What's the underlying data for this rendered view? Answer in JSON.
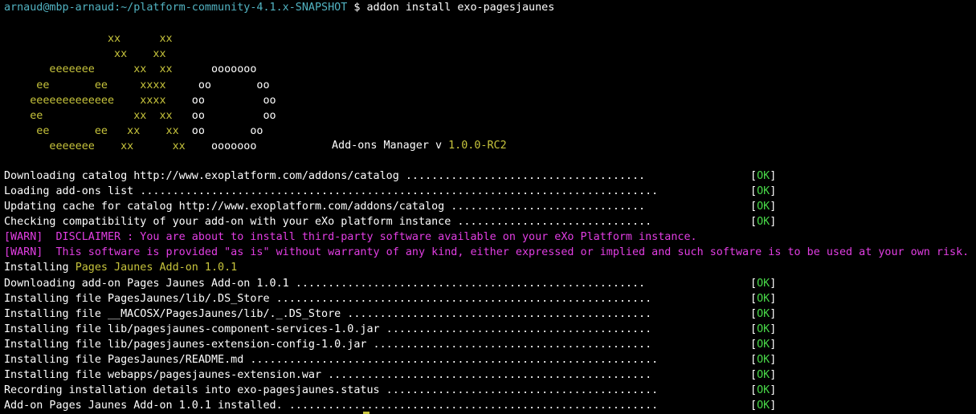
{
  "prompt": {
    "user_host": "arnaud@mbp-arnaud",
    "path": ":~/platform-community-4.1.x-SNAPSHOT",
    "symbol": " $ ",
    "command": "addon install exo-pagesjaunes"
  },
  "banner": {
    "art_lines": [
      {
        "y": "                xx      xx",
        "w": ""
      },
      {
        "y": "                 xx    xx",
        "w": ""
      },
      {
        "y": "       eeeeeee      xx  xx",
        "w": "      ooooooo"
      },
      {
        "y": "     ee       ee     xxxx",
        "w": "     oo       oo"
      },
      {
        "y": "    eeeeeeeeeeeee    xxxx",
        "w": "    oo         oo"
      },
      {
        "y": "    ee              xx  xx",
        "w": "   oo         oo"
      },
      {
        "y": "     ee       ee   xx    xx",
        "w": "  oo       oo"
      },
      {
        "y": "       eeeeeee    xx      xx",
        "w": "    ooooooo"
      }
    ],
    "manager_label": "Add-ons Manager v ",
    "manager_version": "1.0.0-RC2"
  },
  "lines": [
    {
      "type": "ok",
      "text": "Downloading catalog http://www.exoplatform.com/addons/catalog ..................................... "
    },
    {
      "type": "ok",
      "text": "Loading add-ons list ................................................................................ "
    },
    {
      "type": "ok",
      "text": "Updating cache for catalog http://www.exoplatform.com/addons/catalog .............................. "
    },
    {
      "type": "ok",
      "text": "Checking compatibility of your add-on with your eXo platform instance .............................. "
    },
    {
      "type": "warn",
      "text": "[WARN]  DISCLAIMER : You are about to install third-party software available on your eXo Platform instance."
    },
    {
      "type": "warn",
      "text": "[WARN]  This software is provided \"as is\" without warranty of any kind, either expressed or implied and such software is to be used at your own risk."
    },
    {
      "type": "installing",
      "prefix": "Installing ",
      "name": "Pages Jaunes Add-on 1.0.1"
    },
    {
      "type": "ok",
      "text": "Downloading add-on Pages Jaunes Add-on 1.0.1 ...................................................... "
    },
    {
      "type": "ok",
      "text": "Installing file PagesJaunes/lib/.DS_Store .......................................................... "
    },
    {
      "type": "ok",
      "text": "Installing file __MACOSX/PagesJaunes/lib/._.DS_Store ............................................... "
    },
    {
      "type": "ok",
      "text": "Installing file lib/pagesjaunes-component-services-1.0.jar ......................................... "
    },
    {
      "type": "ok",
      "text": "Installing file lib/pagesjaunes-extension-config-1.0.jar ........................................... "
    },
    {
      "type": "ok",
      "text": "Installing file PagesJaunes/README.md ............................................................... "
    },
    {
      "type": "ok",
      "text": "Installing file webapps/pagesjaunes-extension.war .................................................. "
    },
    {
      "type": "ok",
      "text": "Recording installation details into exo-pagesjaunes.status .......................................... "
    },
    {
      "type": "ok",
      "text": "Add-on Pages Jaunes Add-on 1.0.1 installed. ......................................................... "
    }
  ],
  "ok_label": "OK",
  "colors": {
    "background": "#000000",
    "prompt": "#52b3c2",
    "yellow": "#c7c43c",
    "ok": "#48d848",
    "warn": "#e23ee3",
    "text": "#ffffff"
  }
}
